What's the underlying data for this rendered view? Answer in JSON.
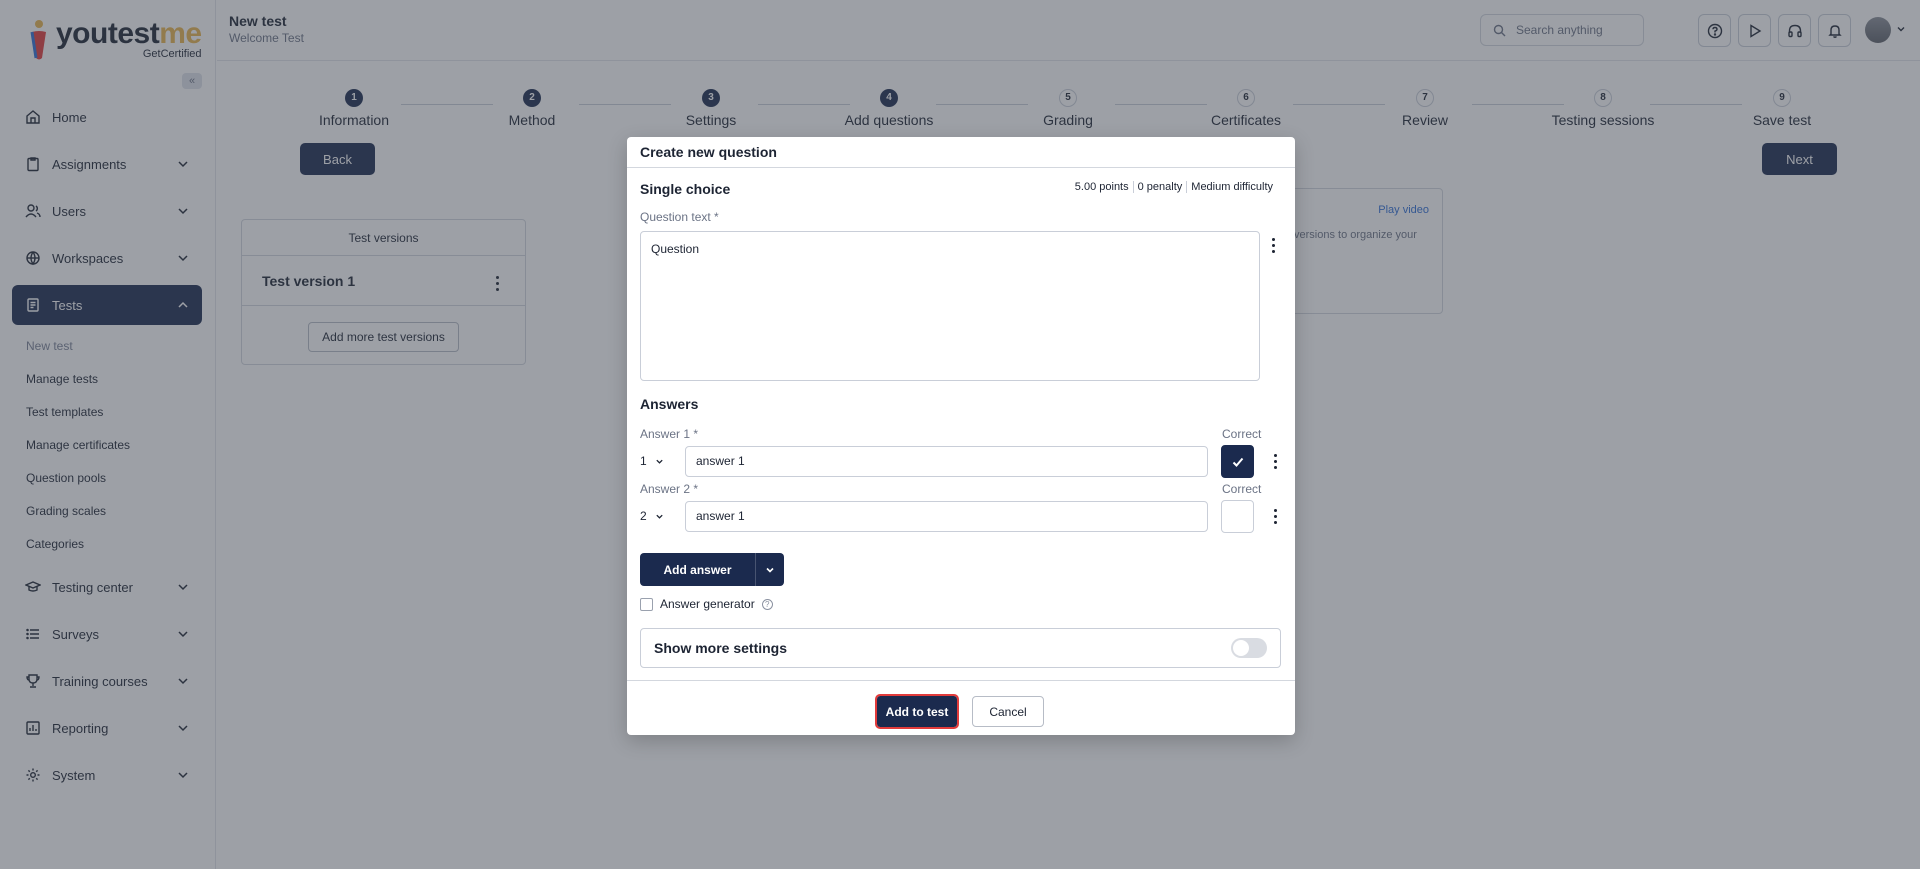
{
  "brand": {
    "name_a": "yout",
    "name_b": "est",
    "name_c": "me",
    "sub": "GetCertified"
  },
  "sidebar": {
    "items": [
      {
        "label": "Home",
        "icon": "home-icon"
      },
      {
        "label": "Assignments",
        "icon": "clipboard-icon"
      },
      {
        "label": "Users",
        "icon": "users-icon"
      },
      {
        "label": "Workspaces",
        "icon": "globe-icon"
      },
      {
        "label": "Tests",
        "icon": "document-icon"
      },
      {
        "label": "Testing center",
        "icon": "graduation-cap-icon"
      },
      {
        "label": "Surveys",
        "icon": "list-icon"
      },
      {
        "label": "Training courses",
        "icon": "trophy-icon"
      },
      {
        "label": "Reporting",
        "icon": "chart-icon"
      },
      {
        "label": "System",
        "icon": "gear-icon"
      }
    ],
    "tests_sub": [
      "New test",
      "Manage tests",
      "Test templates",
      "Manage certificates",
      "Question pools",
      "Grading scales",
      "Categories"
    ]
  },
  "header": {
    "title": "New test",
    "subtitle": "Welcome Test",
    "search_placeholder": "Search anything"
  },
  "stepper": {
    "steps": [
      {
        "num": "1",
        "label": "Information"
      },
      {
        "num": "2",
        "label": "Method"
      },
      {
        "num": "3",
        "label": "Settings"
      },
      {
        "num": "4",
        "label": "Add questions"
      },
      {
        "num": "5",
        "label": "Grading"
      },
      {
        "num": "6",
        "label": "Certificates"
      },
      {
        "num": "7",
        "label": "Review"
      },
      {
        "num": "8",
        "label": "Testing sessions"
      },
      {
        "num": "9",
        "label": "Save test"
      }
    ],
    "back_label": "Back",
    "next_label": "Next"
  },
  "versions": {
    "header": "Test versions",
    "row": "Test version 1",
    "add_label": "Add more test versions"
  },
  "info_card": {
    "play": "Play video",
    "text": "versions to organize your"
  },
  "modal": {
    "title": "Create new question",
    "type": "Single choice",
    "meta": [
      "5.00 points",
      "0 penalty",
      "Medium difficulty"
    ],
    "question_label": "Question text *",
    "question_value": "Question",
    "answers_title": "Answers",
    "correct_label": "Correct",
    "answers": [
      {
        "label": "Answer 1 *",
        "order": "1",
        "value": "answer 1",
        "correct": true
      },
      {
        "label": "Answer 2 *",
        "order": "2",
        "value": "answer 1",
        "correct": false
      }
    ],
    "add_answer_label": "Add answer",
    "generator_label": "Answer generator",
    "more_settings_label": "Show more settings",
    "add_to_test_label": "Add to test",
    "cancel_label": "Cancel"
  },
  "colors": {
    "primary": "#1b2a4e",
    "accent_yellow": "#e9b44c",
    "focus_red": "#e23b3b",
    "link": "#2f6fd6"
  }
}
